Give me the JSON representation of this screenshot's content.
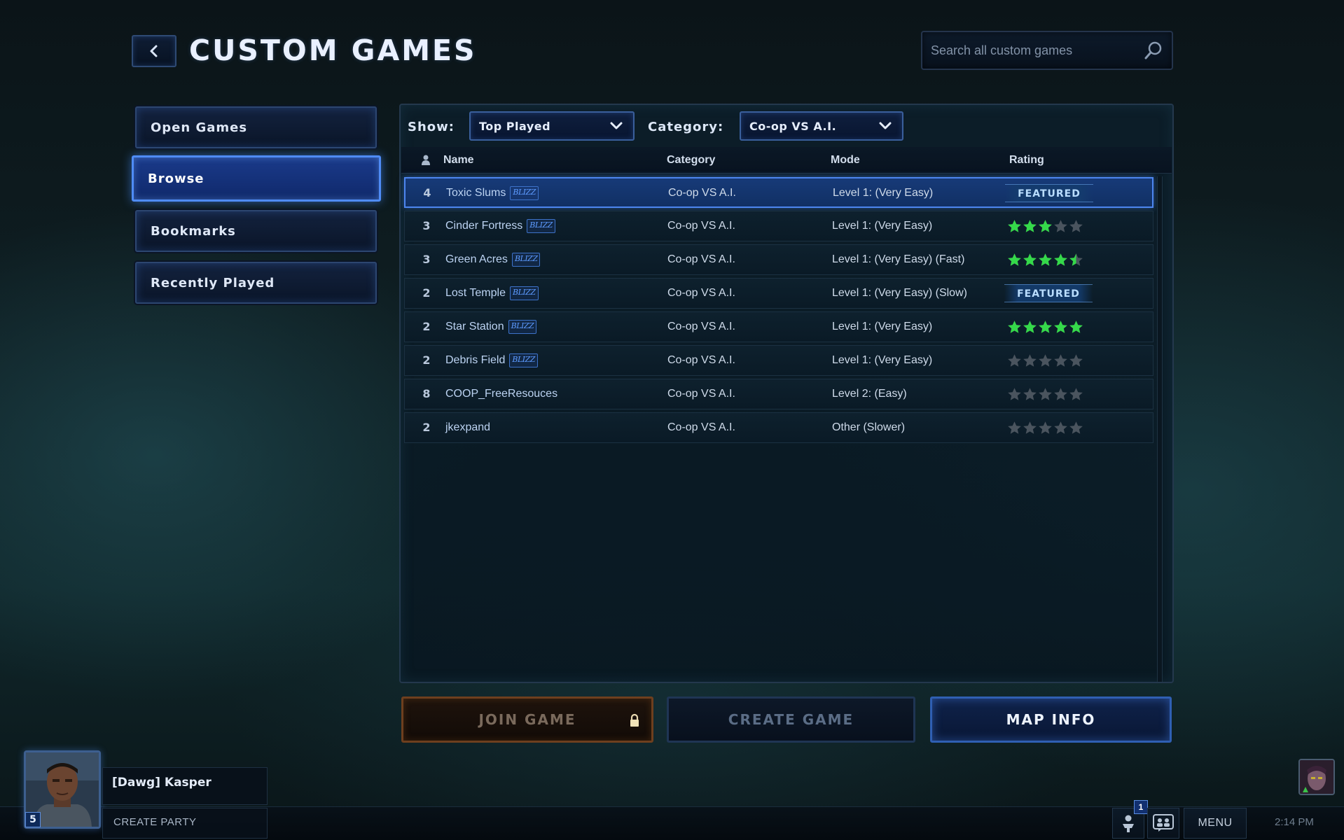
{
  "header": {
    "title": "CUSTOM GAMES",
    "search_placeholder": "Search all custom games"
  },
  "sidebar": {
    "items": [
      {
        "label": "Open Games",
        "active": false
      },
      {
        "label": "Browse",
        "active": true
      },
      {
        "label": "Bookmarks",
        "active": false
      },
      {
        "label": "Recently Played",
        "active": false
      }
    ]
  },
  "filters": {
    "show_label": "Show:",
    "show_value": "Top Played",
    "category_label": "Category:",
    "category_value": "Co-op VS A.I."
  },
  "table": {
    "columns": [
      "Name",
      "Category",
      "Mode",
      "Rating"
    ],
    "blizzard_badge": "BLIZZ",
    "featured_label": "FEATURED",
    "rows": [
      {
        "players": "4",
        "name": "Toxic Slums",
        "blizzard": true,
        "category": "Co-op VS A.I.",
        "mode": "Level 1: (Very Easy)",
        "featured": true,
        "rating": null,
        "selected": true
      },
      {
        "players": "3",
        "name": "Cinder Fortress",
        "blizzard": true,
        "category": "Co-op VS A.I.",
        "mode": "Level 1: (Very Easy)",
        "featured": false,
        "rating": 3
      },
      {
        "players": "3",
        "name": "Green Acres",
        "blizzard": true,
        "category": "Co-op VS A.I.",
        "mode": "Level 1: (Very Easy) (Fast)",
        "featured": false,
        "rating": 4.5
      },
      {
        "players": "2",
        "name": "Lost Temple",
        "blizzard": true,
        "category": "Co-op VS A.I.",
        "mode": "Level 1: (Very Easy) (Slow)",
        "featured": true,
        "rating": null
      },
      {
        "players": "2",
        "name": "Star Station",
        "blizzard": true,
        "category": "Co-op VS A.I.",
        "mode": "Level 1: (Very Easy)",
        "featured": false,
        "rating": 5
      },
      {
        "players": "2",
        "name": "Debris Field",
        "blizzard": true,
        "category": "Co-op VS A.I.",
        "mode": "Level 1: (Very Easy)",
        "featured": false,
        "rating": 0
      },
      {
        "players": "8",
        "name": "COOP_FreeResouces",
        "blizzard": false,
        "category": "Co-op VS A.I.",
        "mode": "Level 2: (Easy)",
        "featured": false,
        "rating": 0
      },
      {
        "players": "2",
        "name": "jkexpand",
        "blizzard": false,
        "category": "Co-op VS A.I.",
        "mode": "Other (Slower)",
        "featured": false,
        "rating": 0
      }
    ]
  },
  "actions": {
    "join": "JOIN GAME",
    "create": "CREATE GAME",
    "map_info": "MAP INFO"
  },
  "player": {
    "name": "[Dawg] Kasper",
    "level": "5",
    "create_party": "CREATE PARTY"
  },
  "tray": {
    "notification_count": "1",
    "menu_label": "MENU",
    "clock": "2:14 PM"
  },
  "colors": {
    "accent_blue": "#4f8cf7",
    "star_green": "#35d94a",
    "star_empty": "#4a545e",
    "join_border": "#6e3f1e"
  },
  "icons": {
    "back": "chevron-left-icon",
    "search": "magnifier-icon",
    "dropdown": "chevron-down-icon",
    "sort": "players-icon",
    "lock": "lock-icon",
    "friends": "friends-icon",
    "chat": "chat-icon"
  }
}
